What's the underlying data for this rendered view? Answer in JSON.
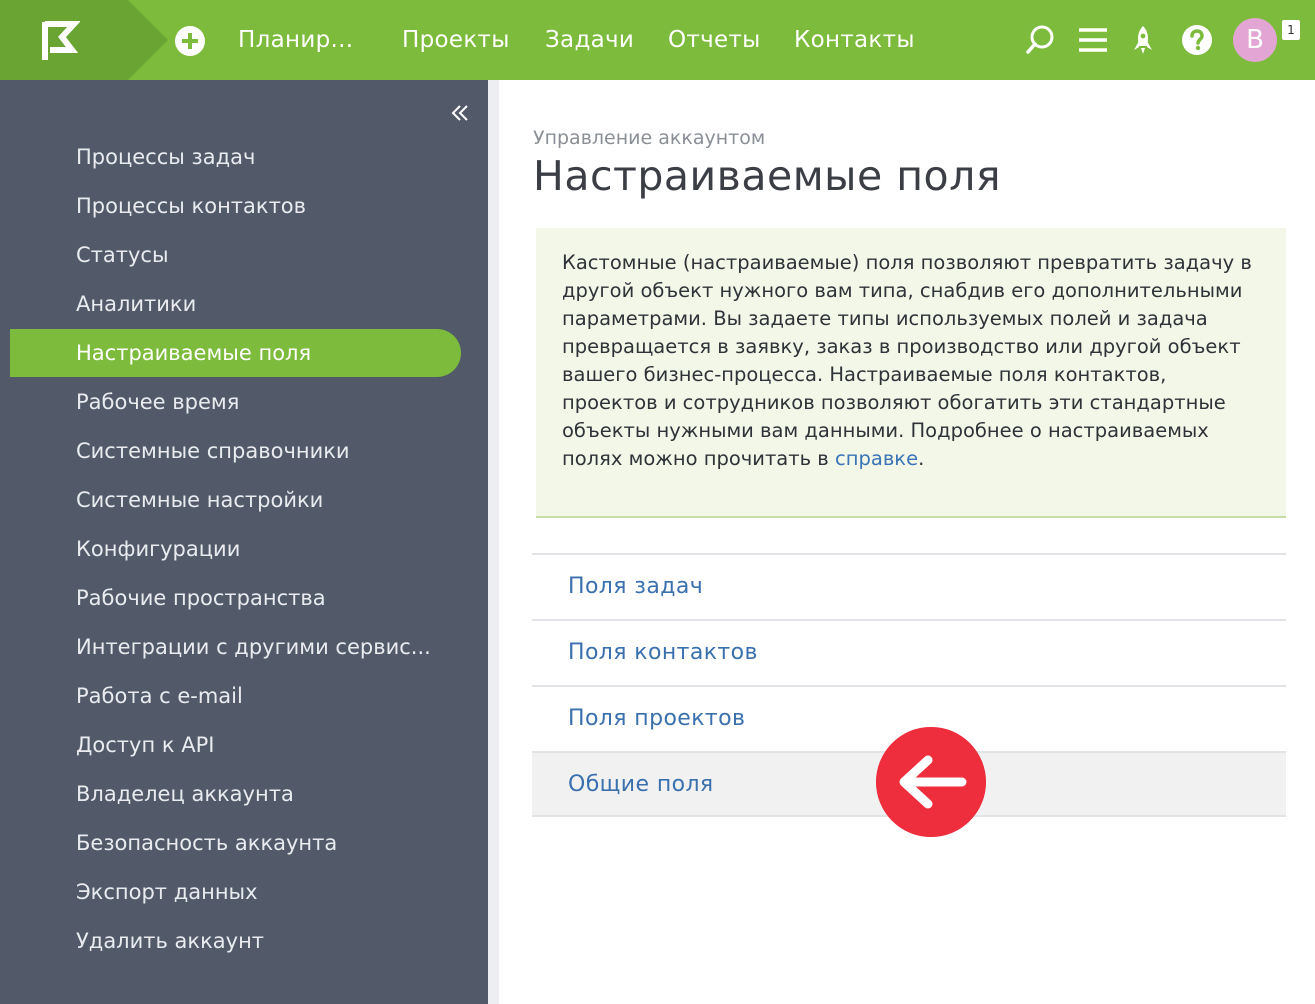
{
  "header": {
    "workspace": "Планир...",
    "nav": [
      "Проекты",
      "Задачи",
      "Отчеты",
      "Контакты"
    ],
    "avatar_letter": "B",
    "notifications": "1",
    "brand_color": "#7dbb3c"
  },
  "sidebar": {
    "items": [
      "Процессы задач",
      "Процессы контактов",
      "Статусы",
      "Аналитики",
      "Настраиваемые поля",
      "Рабочее время",
      "Системные справочники",
      "Системные настройки",
      "Конфигурации",
      "Рабочие пространства",
      "Интеграции с другими сервис...",
      "Работа с e-mail",
      "Доступ к API",
      "Владелец аккаунта",
      "Безопасность аккаунта",
      "Экспорт данных",
      "Удалить аккаунт"
    ],
    "active": "Настраиваемые поля"
  },
  "main": {
    "breadcrumb": "Управление аккаунтом",
    "title": "Настраиваемые поля",
    "info_text": "Кастомные (настраиваемые) поля позволяют превратить задачу в другой объект нужного вам типа, снабдив его дополнительными параметрами. Вы задаете типы используемых полей и задача превращается в заявку, заказ в производство или другой объект вашего бизнес-процесса. Настраиваемые поля контактов, проектов и сотрудников позволяют обогатить эти стандартные объекты нужными вам данными. Подробнее о настраиваемых полях можно прочитать в",
    "info_link": "справке",
    "info_end": ".",
    "sections": [
      "Поля задач",
      "Поля контактов",
      "Поля проектов",
      "Общие поля"
    ],
    "highlighted": "Общие поля"
  }
}
